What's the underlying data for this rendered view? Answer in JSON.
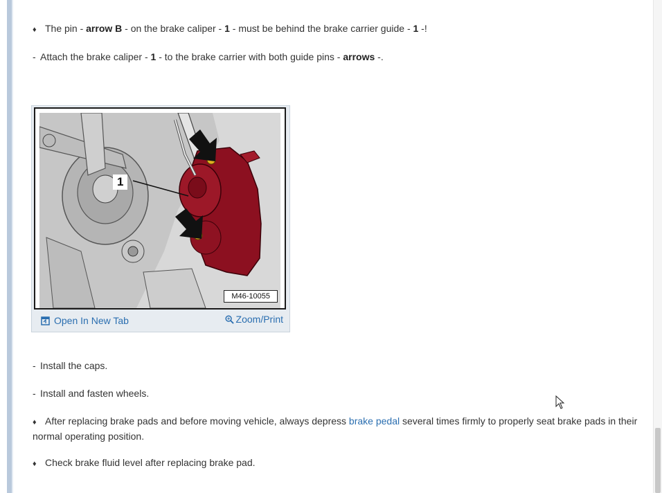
{
  "steps": {
    "pin_note": {
      "bullet": "♦",
      "t1": "The pin - ",
      "b1": "arrow B",
      "t2": " - on the brake caliper - ",
      "b2": "1",
      "t3": " - must be behind the brake carrier guide - ",
      "b3": "1",
      "t4": " -!"
    },
    "attach": {
      "dash": "-",
      "t1": "Attach the brake caliper - ",
      "b1": "1",
      "t2": " - to the brake carrier with both guide pins - ",
      "b2": "arrows",
      "t3": " -."
    },
    "caps": {
      "dash": "-",
      "text": "Install the caps."
    },
    "wheels": {
      "dash": "-",
      "text": "Install and fasten wheels."
    },
    "pedal_note": {
      "bullet": "♦",
      "t1": "After replacing brake pads and before moving vehicle, always depress ",
      "link": "brake pedal",
      "t2": " several times firmly to properly seat brake pads in their normal operating position."
    },
    "fluid_note": {
      "bullet": "♦",
      "text": "Check brake fluid level after replacing brake pad."
    }
  },
  "figure": {
    "callout": "1",
    "ref": "M46-10055",
    "open_tab": "Open In New Tab",
    "zoom": "Zoom/Print"
  },
  "colors": {
    "link": "#2a6eb0",
    "caliper": "#8c1020",
    "side_bar": "#b9c9dc"
  }
}
